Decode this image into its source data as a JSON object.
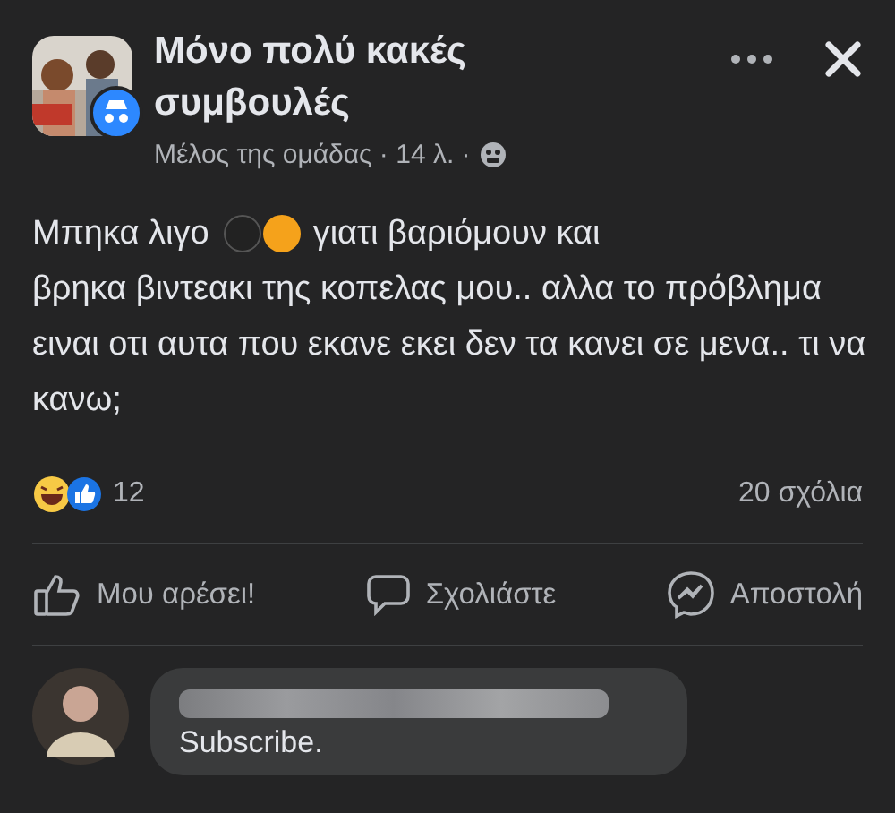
{
  "post": {
    "group_name": "Μόνο πολύ κακές συμβουλές",
    "meta": "Μέλος της ομάδας · 14 λ. ·",
    "text_before": "Μπηκα λιγο",
    "text_mid": "γιατι βαριόμουν και",
    "text_after": "βρηκα βιντεακι της κοπελας μου.. αλλα το πρόβλημα ειναι οτι αυτα που εκανε εκει δεν τα κανει σε μενα.. τι να κανω;",
    "reaction_count": "12",
    "comment_count": "20 σχόλια"
  },
  "actions": [
    {
      "kind": "like",
      "label": "Μου αρέσει!"
    },
    {
      "kind": "comment",
      "label": "Σχολιάστε"
    },
    {
      "kind": "send",
      "label": "Αποστολή"
    }
  ],
  "comment": {
    "text": "Subscribe."
  }
}
